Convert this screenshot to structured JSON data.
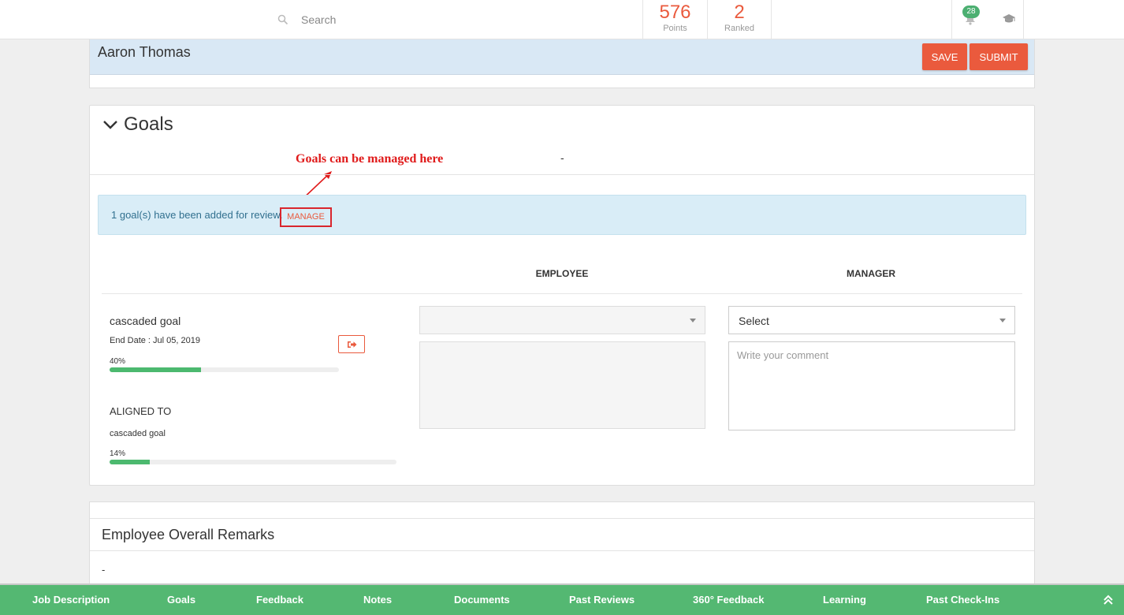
{
  "topbar": {
    "search_placeholder": "Search",
    "points_value": "576",
    "points_label": "Points",
    "ranked_value": "2",
    "ranked_label": "Ranked",
    "notifications_count": "28",
    "icons": [
      "search-icon",
      "bell-icon",
      "graduation-cap-icon"
    ]
  },
  "header": {
    "employee_name": "Aaron Thomas",
    "save_label": "SAVE",
    "submit_label": "SUBMIT"
  },
  "goals": {
    "title": "Goals",
    "annotation": "Goals can be managed here",
    "dash": "-",
    "info_text": "1 goal(s) have been added for review.",
    "manage_label": "MANAGE",
    "columns": {
      "employee": "EMPLOYEE",
      "manager": "MANAGER"
    },
    "goal": {
      "name": "cascaded goal",
      "end_date": "End Date : Jul 05, 2019",
      "progress_label": "40%",
      "progress": 0.4
    },
    "aligned": {
      "heading": "ALIGNED TO",
      "name": "cascaded goal",
      "progress_label": "14%",
      "progress": 0.14
    },
    "employee_select_value": "",
    "manager_select_value": "Select",
    "manager_comment_placeholder": "Write your comment"
  },
  "remarks": {
    "title": "Employee Overall Remarks",
    "value": "-"
  },
  "bottom_nav": {
    "items": [
      "Job Description",
      "Goals",
      "Feedback",
      "Notes",
      "Documents",
      "Past Reviews",
      "360° Feedback",
      "Learning",
      "Past Check-Ins"
    ]
  },
  "colors": {
    "accent": "#ea5a3d",
    "nav_green": "#54b872",
    "progress_green": "#4cb96f",
    "info_bg": "#d9edf7",
    "header_band": "#d9e8f5",
    "annotation_red": "#e01b1b"
  }
}
